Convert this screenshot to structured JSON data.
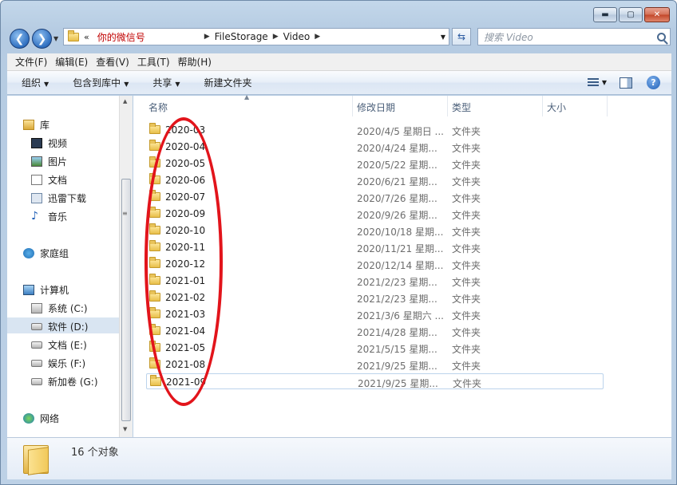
{
  "window": {
    "minimize_glyph": "▬",
    "maximize_glyph": "▢",
    "close_glyph": "✕"
  },
  "addressbar": {
    "chevron": "«",
    "crumbs": [
      "你的微信号",
      "FileStorage",
      "Video"
    ],
    "separator": "▶"
  },
  "search": {
    "placeholder": "搜索 Video"
  },
  "menu": [
    "文件(F)",
    "编辑(E)",
    "查看(V)",
    "工具(T)",
    "帮助(H)"
  ],
  "commands": {
    "organize": "组织",
    "include_in_library": "包含到库中",
    "share": "共享",
    "new_folder": "新建文件夹"
  },
  "navpane": {
    "libraries": "库",
    "lib_items": [
      "视频",
      "图片",
      "文档",
      "迅雷下载",
      "音乐"
    ],
    "homegroup": "家庭组",
    "computer": "计算机",
    "drives": [
      "系统 (C:)",
      "软件 (D:)",
      "文档 (E:)",
      "娱乐 (F:)",
      "新加卷 (G:)"
    ],
    "network": "网络"
  },
  "columns": {
    "name": "名称",
    "date": "修改日期",
    "type": "类型",
    "size": "大小"
  },
  "files": [
    {
      "name": "2020-03",
      "date": "2020/4/5 星期日 ...",
      "type": "文件夹"
    },
    {
      "name": "2020-04",
      "date": "2020/4/24 星期...",
      "type": "文件夹"
    },
    {
      "name": "2020-05",
      "date": "2020/5/22 星期...",
      "type": "文件夹"
    },
    {
      "name": "2020-06",
      "date": "2020/6/21 星期...",
      "type": "文件夹"
    },
    {
      "name": "2020-07",
      "date": "2020/7/26 星期...",
      "type": "文件夹"
    },
    {
      "name": "2020-09",
      "date": "2020/9/26 星期...",
      "type": "文件夹"
    },
    {
      "name": "2020-10",
      "date": "2020/10/18 星期...",
      "type": "文件夹"
    },
    {
      "name": "2020-11",
      "date": "2020/11/21 星期...",
      "type": "文件夹"
    },
    {
      "name": "2020-12",
      "date": "2020/12/14 星期...",
      "type": "文件夹"
    },
    {
      "name": "2021-01",
      "date": "2021/2/23 星期...",
      "type": "文件夹"
    },
    {
      "name": "2021-02",
      "date": "2021/2/23 星期...",
      "type": "文件夹"
    },
    {
      "name": "2021-03",
      "date": "2021/3/6 星期六 ...",
      "type": "文件夹"
    },
    {
      "name": "2021-04",
      "date": "2021/4/28 星期...",
      "type": "文件夹"
    },
    {
      "name": "2021-05",
      "date": "2021/5/15 星期...",
      "type": "文件夹"
    },
    {
      "name": "2021-08",
      "date": "2021/9/25 星期...",
      "type": "文件夹"
    },
    {
      "name": "2021-09",
      "date": "2021/9/25 星期...",
      "type": "文件夹"
    }
  ],
  "details": {
    "count": "16 个对象"
  },
  "colors": {
    "annotation": "#e2141b",
    "selection": "#d9e5f2"
  }
}
